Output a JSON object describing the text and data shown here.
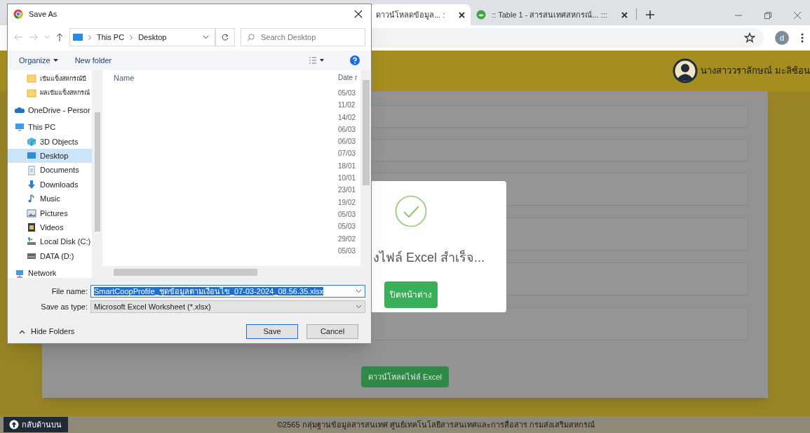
{
  "browser": {
    "tabs": [
      {
        "title": "ดาวน์โหลดข้อมูล... :",
        "selected": true
      },
      {
        "title": ":: Table 1 - สารสนเทศสหกรณ์... :::",
        "selected": false
      }
    ],
    "profile_initial": "d"
  },
  "page": {
    "user_name": "นางสาววราลักษณ์ มะลิซ้อน",
    "form_fields": [
      {
        "kind": "input"
      },
      {
        "kind": "input"
      },
      {
        "kind": "textarea"
      },
      {
        "kind": "textarea"
      },
      {
        "kind": "textarea"
      },
      {
        "kind": "textarea"
      }
    ],
    "download_button": "ดาวน์โหลดไฟล์ Excel",
    "back_to_top": "กลับด้านบน",
    "footer_text": "©2565 กลุ่มฐานข้อมูลสารสนเทศ ศูนย์เทคโนโลยีสารสนเทศและการสื่อสาร กรมส่งเสริมสหกรณ์"
  },
  "modal": {
    "message": "งไฟล์ Excel สำเร็จ...",
    "close_button": "ปิดหน้าต่าง"
  },
  "save_dialog": {
    "title": "Save As",
    "breadcrumb": [
      "This PC",
      "Desktop"
    ],
    "search": {
      "placeholder": "Search Desktop"
    },
    "toolbar": [
      "Organize",
      "New folder"
    ],
    "quick_access": [
      {
        "label": "เข้มแข็งสหกรณ์ปี",
        "selected": false
      },
      {
        "label": "ผลเข้มแข็งสหกรณ์",
        "selected": false
      }
    ],
    "roots": [
      {
        "label": "OneDrive - Persor",
        "selected": false
      },
      {
        "label": "This PC",
        "selected": false,
        "children": [
          {
            "label": "3D Objects",
            "selected": false
          },
          {
            "label": "Desktop",
            "selected": true
          },
          {
            "label": "Documents",
            "selected": false
          },
          {
            "label": "Downloads",
            "selected": false
          },
          {
            "label": "Music",
            "selected": false
          },
          {
            "label": "Pictures",
            "selected": false
          },
          {
            "label": "Videos",
            "selected": false
          },
          {
            "label": "Local Disk (C:)",
            "selected": false
          },
          {
            "label": "DATA (D:)",
            "selected": false
          }
        ]
      },
      {
        "label": "Network",
        "selected": false
      }
    ],
    "columns": [
      "Name",
      "Date r"
    ],
    "dates": [
      "05/03",
      "11/02",
      "14/02",
      "06/03",
      "06/03",
      "07/03",
      "18/01",
      "10/01",
      "23/01",
      "19/02",
      "05/03",
      "05/03",
      "29/02",
      "05/03"
    ],
    "file_name_label": "File name:",
    "file_name": "SmartCoopProfile_ชุดข้อมูลตามเงื่อนไข_07-03-2024_08.56.35.xlsx",
    "save_as_type_label": "Save as type:",
    "save_as_type": "Microsoft Excel Worksheet (*.xlsx)",
    "hide_folders": "Hide Folders",
    "buttons": [
      "Save",
      "Cancel"
    ]
  }
}
